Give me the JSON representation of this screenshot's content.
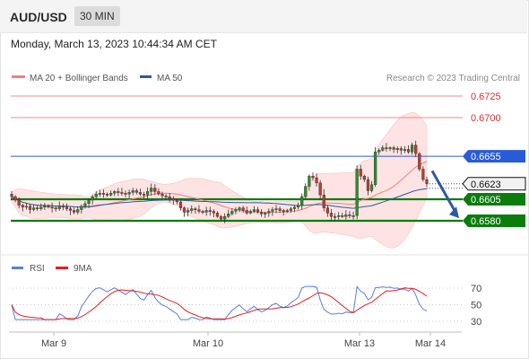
{
  "header": {
    "symbol": "AUD/USD",
    "timeframe": "30 MIN",
    "datetime": "Monday, March 13, 2023 10:44:34 AM CET"
  },
  "legend": {
    "ma20": {
      "label": "MA 20 + Bollinger Bands",
      "color": "#f08080"
    },
    "ma50": {
      "label": "MA 50",
      "color": "#2c5aa0"
    },
    "copyright": "Research © 2023 Trading Central"
  },
  "rsi_legend": {
    "rsi": {
      "label": "RSI",
      "color": "#5b7fd6"
    },
    "ma9": {
      "label": "9MA",
      "color": "#e02020"
    }
  },
  "levels": [
    {
      "label": "0.6725",
      "value": 0.6725,
      "style": "red"
    },
    {
      "label": "0.6700",
      "value": 0.67,
      "style": "red"
    },
    {
      "label": "0.6655",
      "value": 0.6655,
      "style": "blue"
    },
    {
      "label": "0.6605",
      "value": 0.6605,
      "style": "green"
    },
    {
      "label": "0.6580",
      "value": 0.658,
      "style": "green"
    }
  ],
  "last_price": {
    "label": "0.6623",
    "value": 0.6623
  },
  "rsi_ticks": [
    "70",
    "50",
    "30"
  ],
  "x_labels": [
    "Mar 9",
    "Mar 10",
    "Mar 13",
    "Mar 14"
  ],
  "colors": {
    "up": "#2e8b2e",
    "down": "#c0392b",
    "support": "#0a7d0a",
    "resistance": "#2a5bd7",
    "arrow": "#2c5aa0"
  },
  "chart_data": [
    {
      "type": "candlestick",
      "title": "AUD/USD",
      "timeframe": "30 MIN",
      "ylim": [
        0.6555,
        0.6745
      ],
      "x_labels": [
        "Mar 9",
        "Mar 10",
        "Mar 13",
        "Mar 14"
      ],
      "closes": [
        0.6608,
        0.6604,
        0.6598,
        0.6596,
        0.6597,
        0.6593,
        0.6595,
        0.6594,
        0.6596,
        0.6597,
        0.6596,
        0.6595,
        0.6594,
        0.6597,
        0.6596,
        0.6594,
        0.6592,
        0.659,
        0.6593,
        0.6597,
        0.66,
        0.6604,
        0.6608,
        0.6611,
        0.6612,
        0.6611,
        0.661,
        0.6612,
        0.6614,
        0.6613,
        0.6612,
        0.6611,
        0.6613,
        0.6615,
        0.6613,
        0.6611,
        0.661,
        0.6614,
        0.6618,
        0.6614,
        0.6611,
        0.6609,
        0.6608,
        0.6606,
        0.6604,
        0.6602,
        0.6595,
        0.659,
        0.6592,
        0.6594,
        0.6593,
        0.6591,
        0.659,
        0.6592,
        0.6591,
        0.6589,
        0.6585,
        0.6582,
        0.6585,
        0.6588,
        0.6591,
        0.6593,
        0.6595,
        0.6592,
        0.6589,
        0.6591,
        0.6593,
        0.659,
        0.6588,
        0.6589,
        0.6591,
        0.6593,
        0.6594,
        0.6592,
        0.6591,
        0.6592,
        0.6594,
        0.6596,
        0.6598,
        0.6608,
        0.662,
        0.6632,
        0.663,
        0.6624,
        0.661,
        0.6595,
        0.6589,
        0.6585,
        0.6585,
        0.6586,
        0.6585,
        0.6587,
        0.6586,
        0.6586,
        0.664,
        0.6632,
        0.6628,
        0.6615,
        0.6622,
        0.666,
        0.6662,
        0.6665,
        0.6664,
        0.6665,
        0.6663,
        0.6664,
        0.6662,
        0.6663,
        0.666,
        0.6668,
        0.6658,
        0.664,
        0.6628,
        0.6623
      ],
      "levels": {
        "resistance": [
          0.6655,
          0.67,
          0.6725
        ],
        "support": [
          0.6605,
          0.658
        ]
      },
      "last_price": 0.6623,
      "series": [
        {
          "name": "MA 20 + Bollinger Bands",
          "color": "#f08080"
        },
        {
          "name": "MA 50",
          "color": "#2c5aa0"
        }
      ]
    },
    {
      "type": "line",
      "title": "RSI",
      "ylim": [
        20,
        80
      ],
      "y_ticks": [
        70,
        50,
        30
      ],
      "series": [
        {
          "name": "RSI",
          "color": "#5b7fd6"
        },
        {
          "name": "9MA",
          "color": "#e02020"
        }
      ]
    }
  ]
}
